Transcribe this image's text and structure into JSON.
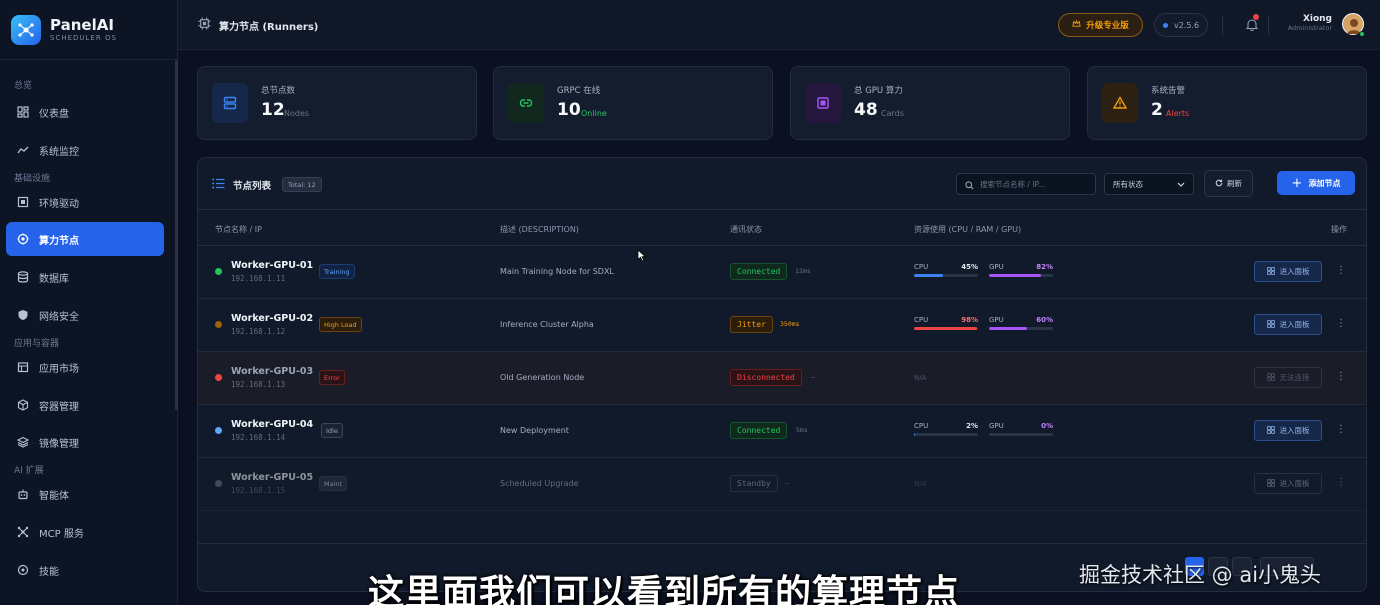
{
  "brand": {
    "name": "PanelAI",
    "subtitle": "SCHEDULER OS"
  },
  "sidebar": {
    "groups": [
      "总览",
      "基础设施",
      "应用与容器",
      "AI 扩展"
    ],
    "items": [
      {
        "label": "仪表盘",
        "icon": "dashboard-icon"
      },
      {
        "label": "系统监控",
        "icon": "activity-icon"
      },
      {
        "label": "环境驱动",
        "icon": "chip-icon"
      },
      {
        "label": "算力节点",
        "icon": "cpu-icon",
        "active": true
      },
      {
        "label": "数据库",
        "icon": "database-icon"
      },
      {
        "label": "网络安全",
        "icon": "shield-icon"
      },
      {
        "label": "应用市场",
        "icon": "store-icon"
      },
      {
        "label": "容器管理",
        "icon": "box-icon"
      },
      {
        "label": "镜像管理",
        "icon": "layers-icon"
      },
      {
        "label": "智能体",
        "icon": "robot-icon"
      },
      {
        "label": "MCP 服务",
        "icon": "network-icon"
      },
      {
        "label": "技能",
        "icon": "skill-icon"
      }
    ]
  },
  "header": {
    "title": "算力节点 (Runners)",
    "upgrade_label": "升级专业版",
    "version": "v2.5.6",
    "user_name": "Xiong",
    "user_role": "Administrator"
  },
  "stats": [
    {
      "label": "总节点数",
      "value": "12",
      "unit": "Nodes",
      "icon": "server-icon",
      "color": "#3b82f6"
    },
    {
      "label": "GRPC 在线",
      "value": "10",
      "unit": "Online",
      "icon": "link-icon",
      "color": "#22c55e"
    },
    {
      "label": "总 GPU 算力",
      "value": "48",
      "unit": "Cards",
      "icon": "gpu-icon",
      "color": "#a855f7"
    },
    {
      "label": "系统告警",
      "value": "2",
      "unit": "Alerts",
      "icon": "warning-icon",
      "color": "#f59e0b"
    }
  ],
  "node_list": {
    "title": "节点列表",
    "total": "Total: 12",
    "search_placeholder": "搜索节点名称 / IP...",
    "status_filter": "所有状态",
    "refresh_label": "刷新",
    "add_label": "添加节点",
    "columns": [
      "节点名称 / IP",
      "描述 (DESCRIPTION)",
      "通讯状态",
      "资源使用 (CPU / RAM / GPU)",
      "操作"
    ],
    "rows": [
      {
        "name": "Worker-GPU-01",
        "ip": "192.168.1.11",
        "tag": "Training",
        "tag_color": "#3b82f6",
        "dot": "#22c55e",
        "description": "Main Training Node for SDXL",
        "comm": "Connected",
        "comm_color": "#22c55e",
        "latency": "12ms",
        "latency_color": "#64748b",
        "cpu_label": "CPU",
        "cpu": "45%",
        "cpu_pct": 45,
        "cpu_color": "#3b82f6",
        "gpu_label": "GPU",
        "gpu": "82%",
        "gpu_pct": 82,
        "gpu_color": "#a855f7",
        "action": "进入面板"
      },
      {
        "name": "Worker-GPU-02",
        "ip": "192.168.1.12",
        "tag": "High Load",
        "tag_color": "#f59e0b",
        "dot": "#a16207",
        "description": "Inference Cluster Alpha",
        "comm": "Jitter",
        "comm_color": "#f59e0b",
        "latency": "350ms",
        "latency_color": "#f59e0b",
        "cpu_label": "CPU",
        "cpu": "98%",
        "cpu_pct": 98,
        "cpu_color": "#ef4444",
        "gpu_label": "GPU",
        "gpu": "60%",
        "gpu_pct": 60,
        "gpu_color": "#a855f7",
        "action": "进入面板"
      },
      {
        "name": "Worker-GPU-03",
        "ip": "192.168.1.13",
        "tag": "Error",
        "tag_color": "#ef4444",
        "dot": "#ef4444",
        "description": "Old Generation Node",
        "comm": "Disconnected",
        "comm_color": "#ef4444",
        "latency": "—",
        "latency_color": "#64748b",
        "na": "N/A",
        "action": "无法连接"
      },
      {
        "name": "Worker-GPU-04",
        "ip": "192.168.1.14",
        "tag": "Idle",
        "tag_color": "#94a3b8",
        "dot": "#60a5fa",
        "description": "New Deployment",
        "comm": "Connected",
        "comm_color": "#22c55e",
        "latency": "5ms",
        "latency_color": "#64748b",
        "cpu_label": "CPU",
        "cpu": "2%",
        "cpu_pct": 2,
        "cpu_color": "#3b82f6",
        "gpu_label": "GPU",
        "gpu": "0%",
        "gpu_pct": 0,
        "gpu_color": "#a855f7",
        "action": "进入面板"
      },
      {
        "name": "Worker-GPU-05",
        "ip": "192.168.1.15",
        "tag": "Maint",
        "tag_color": "#94a3b8",
        "dot": "#64748b",
        "description": "Scheduled Upgrade",
        "comm": "Standby",
        "comm_color": "#94a3b8",
        "latency": "—",
        "latency_color": "#64748b",
        "na": "N/A",
        "action": "进入面板"
      }
    ]
  },
  "overlay": {
    "subtitle": "这里面我们可以看到所有的算理节点",
    "watermark": "掘金技术社区 @ ai小鬼头"
  }
}
